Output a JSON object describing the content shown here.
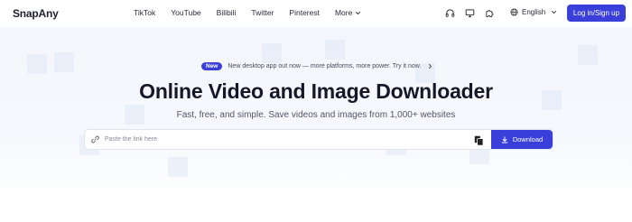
{
  "brand": {
    "logo_text": "SnapAny"
  },
  "nav": {
    "links": [
      "TikTok",
      "YouTube",
      "Bilibili",
      "Twitter",
      "Pinterest"
    ],
    "more_label": "More",
    "icons": [
      "headphones-icon",
      "monitor-icon",
      "puzzle-icon"
    ],
    "language": "English",
    "login_label": "Log in/Sign up"
  },
  "announcement": {
    "badge": "New",
    "text": "New desktop app out now — more platforms, more power. Try it now."
  },
  "hero": {
    "title": "Online Video and Image Downloader",
    "subtitle": "Fast, free, and simple. Save videos and images from 1,000+ websites"
  },
  "search": {
    "placeholder": "Paste the link here",
    "value": "",
    "button_label": "Download"
  },
  "colors": {
    "accent": "#3b3fd9",
    "text_dark": "#17172a",
    "hero_bg": "#f3f6fc"
  }
}
